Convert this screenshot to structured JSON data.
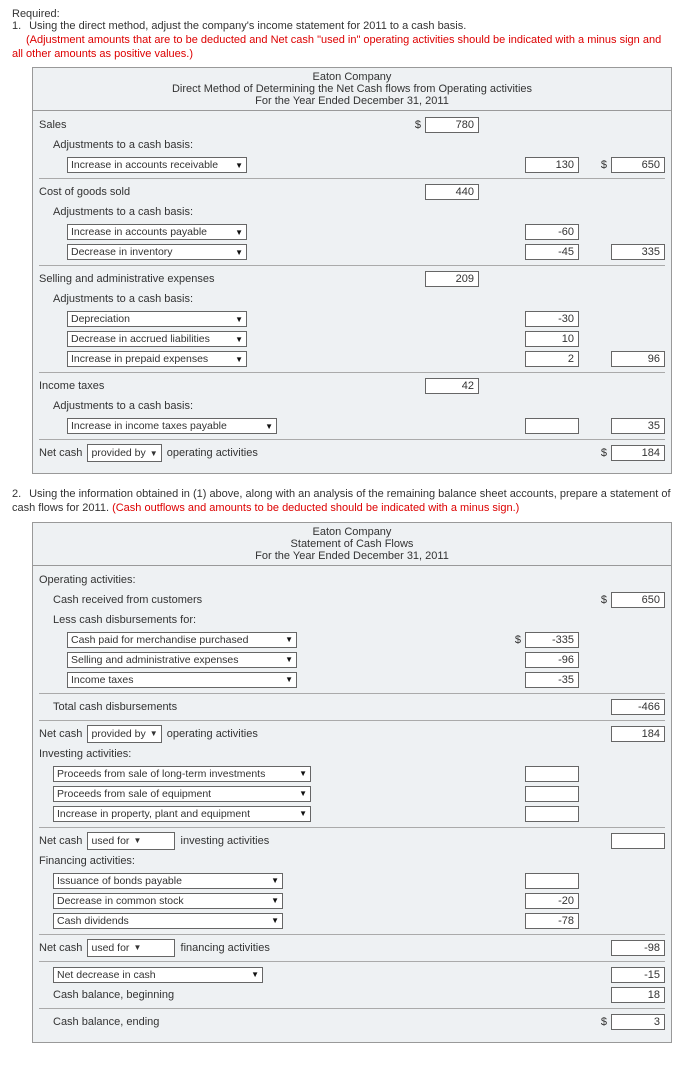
{
  "required_label": "Required:",
  "q1": {
    "num": "1.",
    "text": "Using the direct method, adjust the company's income statement for 2011 to a cash basis.",
    "red": "(Adjustment amounts that are to be deducted and Net cash \"used in\" operating activities should be indicated with a minus sign and all other amounts as positive values.)"
  },
  "panel1": {
    "h1": "Eaton Company",
    "h2": "Direct Method of Determining the Net Cash flows from Operating activities",
    "h3": "For the Year Ended December 31, 2011",
    "sales_label": "Sales",
    "sales_val": "780",
    "adj_label": "Adjustments to a cash basis:",
    "adj1_sel": "Increase in accounts receivable",
    "adj1_val": "130",
    "adj1_total": "650",
    "cogs_label": "Cost of goods sold",
    "cogs_val": "440",
    "cogs_a1_sel": "Increase in accounts payable",
    "cogs_a1_val": "-60",
    "cogs_a2_sel": "Decrease in inventory",
    "cogs_a2_val": "-45",
    "cogs_total": "335",
    "sga_label": "Selling and administrative expenses",
    "sga_val": "209",
    "sga_a1_sel": "Depreciation",
    "sga_a1_val": "-30",
    "sga_a2_sel": "Decrease in accrued liabilities",
    "sga_a2_val": "10",
    "sga_a3_sel": "Increase in prepaid expenses",
    "sga_a3_val": "2",
    "sga_total": "96",
    "tax_label": "Income taxes",
    "tax_val": "42",
    "tax_a1_sel": "Increase in income taxes payable",
    "tax_total": "35",
    "net_label_pre": "Net cash",
    "net_sel": "provided by",
    "net_label_post": "operating activities",
    "net_total": "184"
  },
  "q2": {
    "num": "2.",
    "text": "Using the information obtained in (1) above, along with an analysis of the remaining balance sheet accounts, prepare a statement of cash flows for 2011.",
    "red": "(Cash outflows and amounts to be deducted should be indicated with a minus sign.)"
  },
  "panel2": {
    "h1": "Eaton Company",
    "h2": "Statement of Cash Flows",
    "h3": "For the Year Ended December 31, 2011",
    "op_label": "Operating activities:",
    "op_recv": "Cash received from customers",
    "op_recv_val": "650",
    "less_label": "Less cash disbursements for:",
    "d1_sel": "Cash paid for merchandise purchased",
    "d1_val": "-335",
    "d2_sel": "Selling and administrative expenses",
    "d2_val": "-96",
    "d3_sel": "Income taxes",
    "d3_val": "-35",
    "tcd_label": "Total cash disbursements",
    "tcd_val": "-466",
    "op_net_pre": "Net cash",
    "op_net_sel": "provided by",
    "op_net_post": "operating activities",
    "op_net_val": "184",
    "inv_label": "Investing activities:",
    "inv1_sel": "Proceeds from sale of long-term investments",
    "inv2_sel": "Proceeds from sale of equipment",
    "inv3_sel": "Increase in property, plant and equipment",
    "inv_net_pre": "Net cash",
    "inv_net_sel": "used for",
    "inv_net_post": "investing activities",
    "fin_label": "Financing activities:",
    "fin1_sel": "Issuance of bonds payable",
    "fin2_sel": "Decrease in common stock",
    "fin2_val": "-20",
    "fin3_sel": "Cash dividends",
    "fin3_val": "-78",
    "fin_net_pre": "Net cash",
    "fin_net_sel": "used for",
    "fin_net_post": "financing activities",
    "fin_net_val": "-98",
    "nd_sel": "Net decrease in cash",
    "nd_val": "-15",
    "beg_label": "Cash balance, beginning",
    "beg_val": "18",
    "end_label": "Cash balance, ending",
    "end_val": "3"
  },
  "dollar": "$"
}
